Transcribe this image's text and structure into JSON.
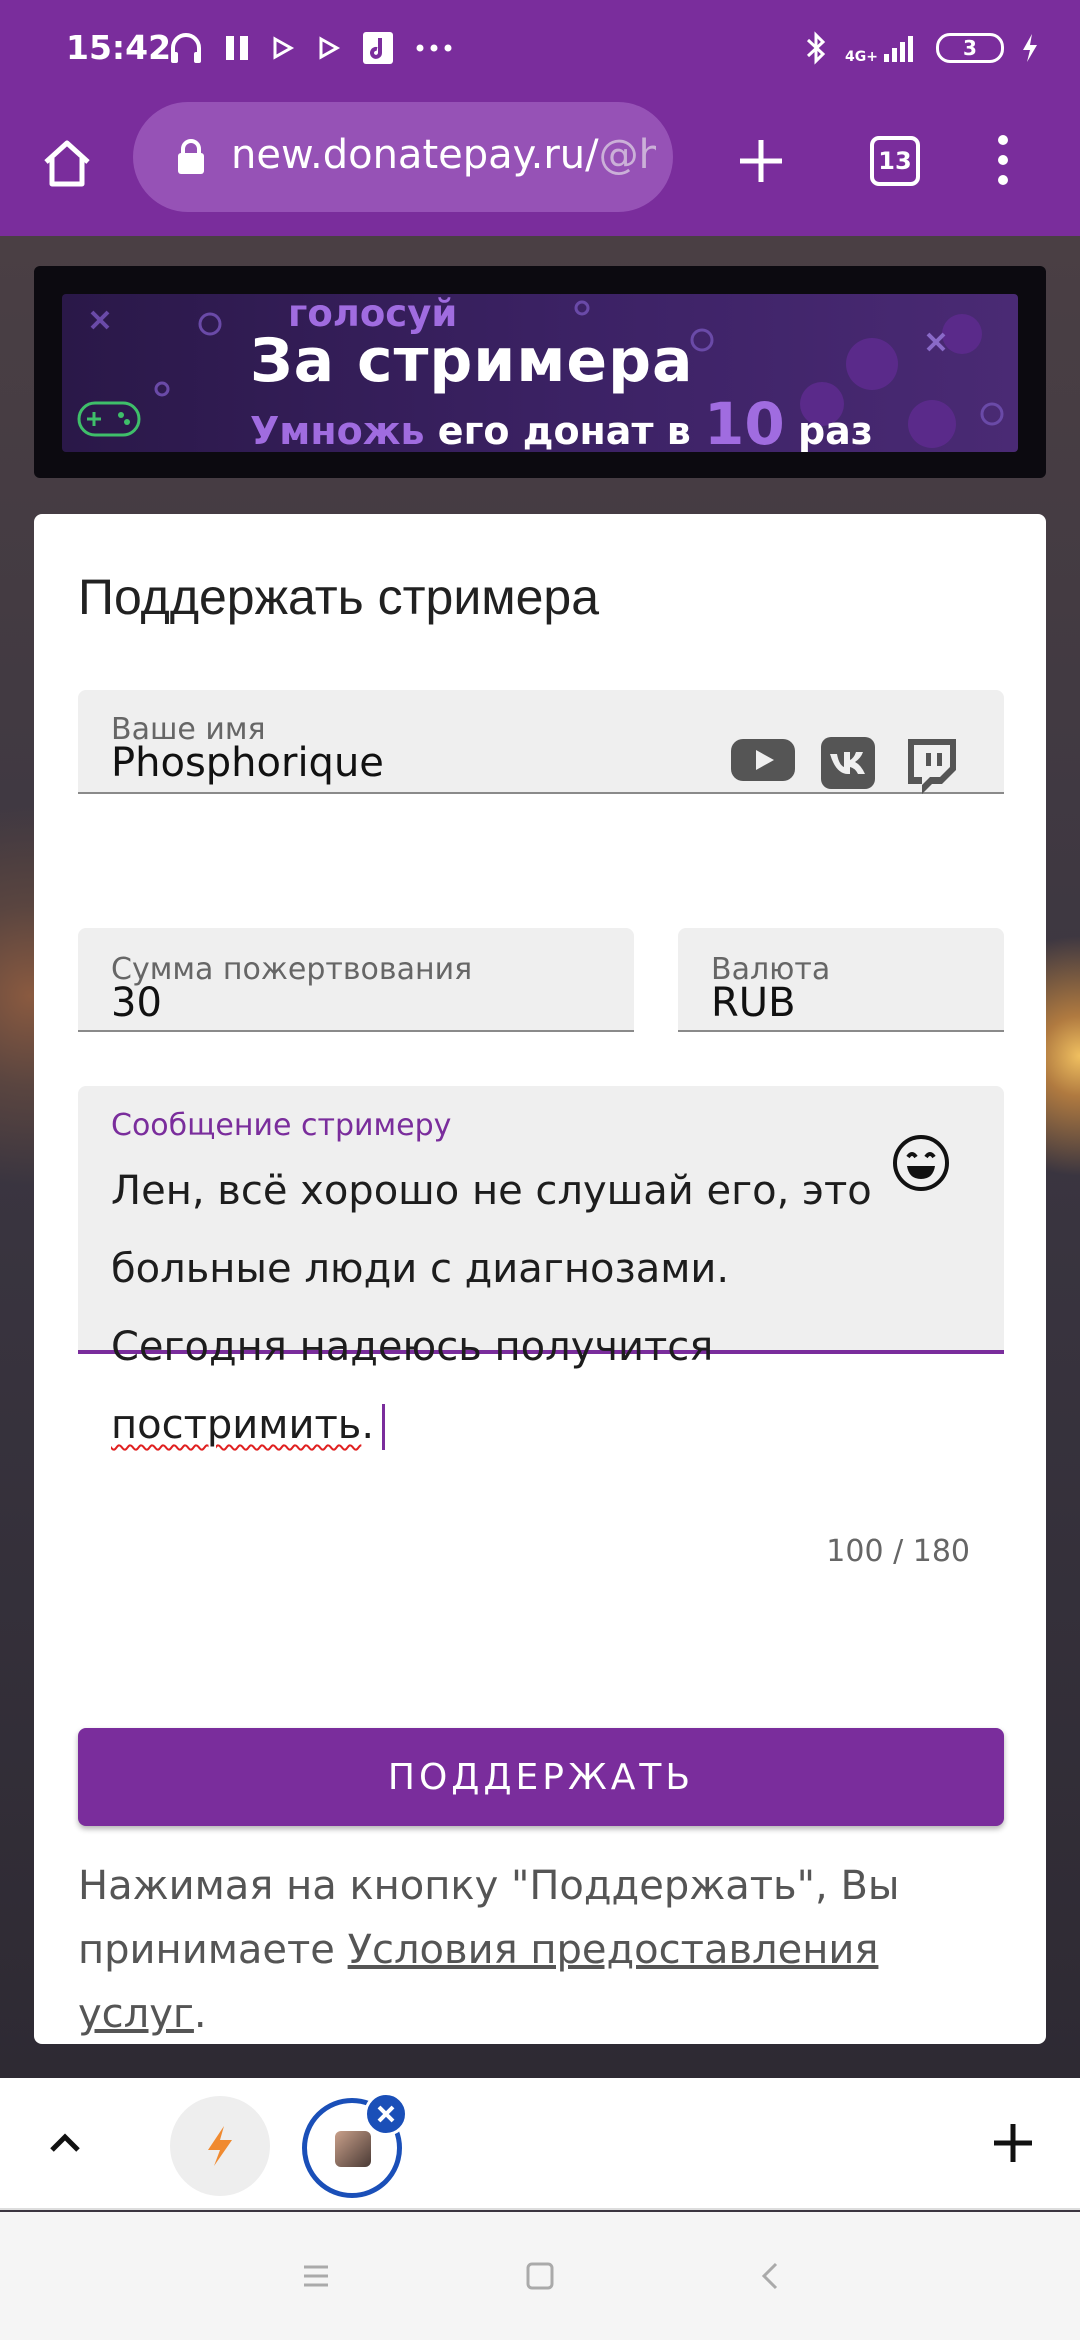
{
  "status_bar": {
    "time": "15:42",
    "network": "4G+",
    "battery": "3"
  },
  "browser": {
    "url_main": "new.donatepay.ru/",
    "url_dim": "@h",
    "tab_count": "13"
  },
  "banner": {
    "vote": "голосуй",
    "title": "За стримера",
    "line_multiply": "Умножь",
    "line_middle": "его донат в",
    "line_number": "10",
    "line_end": "раз"
  },
  "form": {
    "title": "Поддержать стримера",
    "name_label": "Ваше имя",
    "name_value": "Phosphorique",
    "amount_label": "Сумма пожертвования",
    "amount_value": "30",
    "currency_label": "Валюта",
    "currency_value": "RUB",
    "message_label": "Сообщение стримеру",
    "message_text": "Лен, всё хорошо не слушай его, это больные люди с диагнозами. Сегодня надеюсь получится ",
    "message_misspelled": "постримить",
    "message_tail": ".",
    "counter": "100 / 180",
    "submit_label": "ПОДДЕРЖАТЬ",
    "terms_before": "Нажимая на кнопку \"Поддержать\", Вы принимаете ",
    "terms_link": "Условия предоставления услуг",
    "terms_after": "."
  },
  "colors": {
    "brand": "#7a2d9c",
    "card": "#ffffff",
    "field_bg": "#efefef"
  },
  "icons": {
    "social": [
      "youtube-icon",
      "vk-icon",
      "twitch-icon"
    ],
    "message": "smile-icon"
  }
}
